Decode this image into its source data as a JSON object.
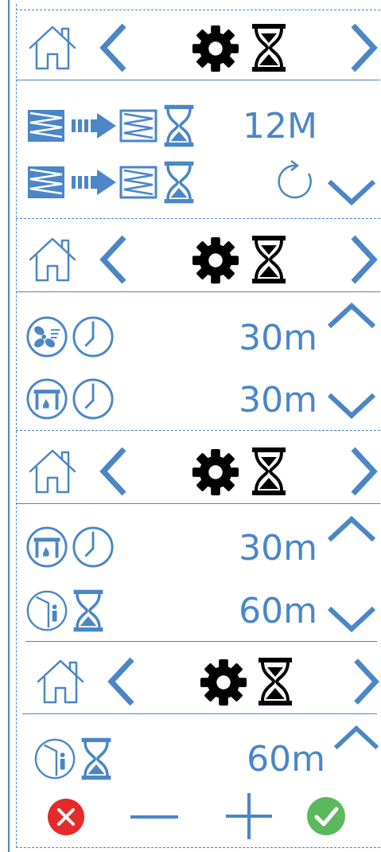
{
  "colors": {
    "accent": "#4a86c8",
    "icon_dark": "#000000",
    "cancel": "#e52a2a",
    "confirm": "#5cb85c"
  },
  "panels": [
    {
      "header": {
        "icons": [
          "home-icon",
          "chevron-left-icon",
          "gear-icon",
          "hourglass-icon",
          "chevron-right-icon"
        ]
      },
      "rows": [
        {
          "icons": [
            "filter-to-filter-icon",
            "hourglass-icon"
          ],
          "value": "12M"
        },
        {
          "icons": [
            "filter-to-filter-icon",
            "hourglass-icon",
            "reset-icon"
          ],
          "value": ""
        }
      ]
    },
    {
      "header": {
        "icons": [
          "home-icon",
          "chevron-left-icon",
          "gear-icon",
          "hourglass-icon",
          "chevron-right-icon"
        ]
      },
      "rows": [
        {
          "icons": [
            "fan-icon",
            "clock-icon"
          ],
          "value": "30m"
        },
        {
          "icons": [
            "fireplace-icon",
            "clock-icon"
          ],
          "value": "30m"
        }
      ]
    },
    {
      "header": {
        "icons": [
          "home-icon",
          "chevron-left-icon",
          "gear-icon",
          "hourglass-icon",
          "chevron-right-icon"
        ]
      },
      "rows": [
        {
          "icons": [
            "fireplace-icon",
            "clock-icon"
          ],
          "value": "30m"
        },
        {
          "icons": [
            "presence-icon",
            "hourglass-icon"
          ],
          "value": "60m"
        }
      ]
    },
    {
      "header": {
        "icons": [
          "home-icon",
          "chevron-left-icon",
          "gear-icon",
          "hourglass-icon",
          "chevron-right-icon"
        ]
      },
      "rows": [
        {
          "icons": [
            "presence-icon",
            "hourglass-icon"
          ],
          "value": "60m"
        }
      ],
      "actions": [
        "cancel",
        "minus",
        "plus",
        "confirm"
      ]
    }
  ]
}
